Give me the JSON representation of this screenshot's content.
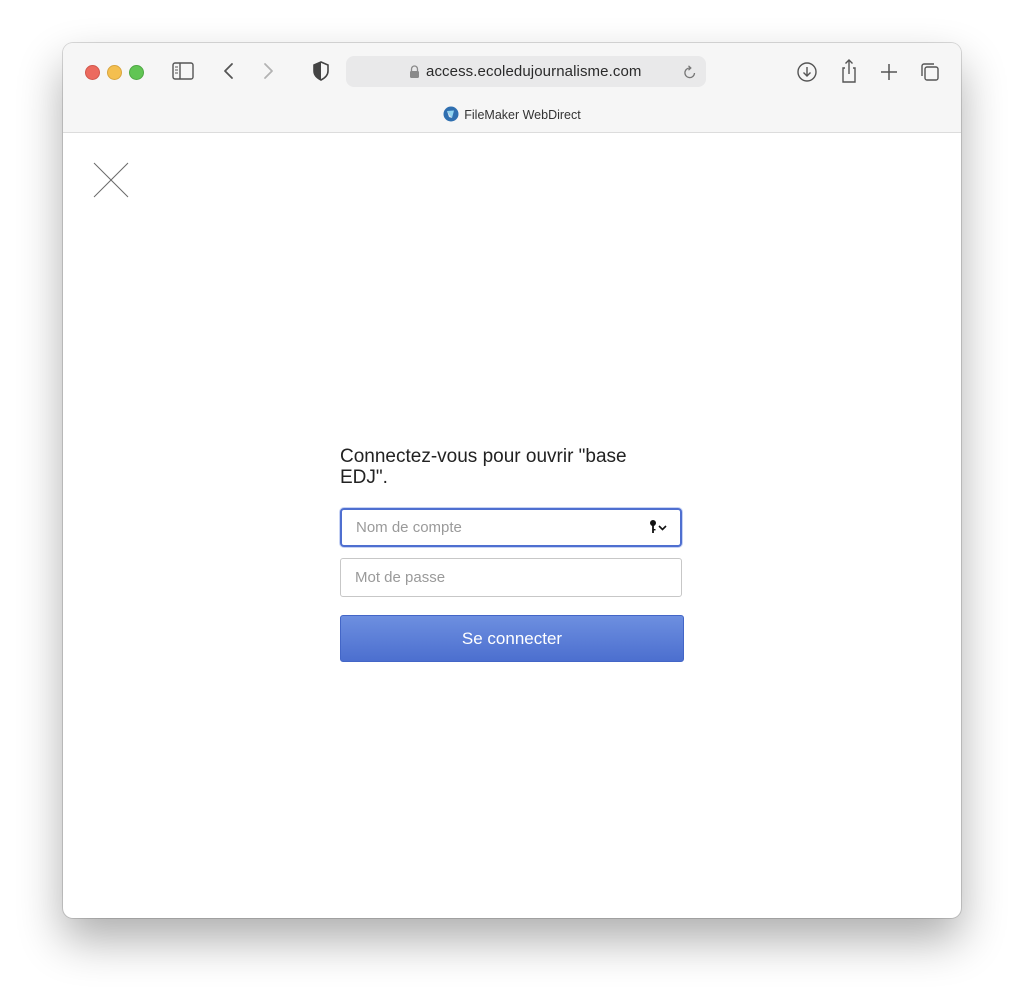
{
  "browser": {
    "url": "access.ecoledujournalisme.com",
    "tab_title": "FileMaker WebDirect",
    "toolbar_icons": [
      "sidebar-icon",
      "back-icon",
      "forward-icon",
      "shield-icon",
      "lock-icon",
      "reload-icon",
      "download-icon",
      "share-icon",
      "new-tab-icon",
      "tab-overview-icon"
    ]
  },
  "login": {
    "heading": "Connectez-vous pour ouvrir \"base EDJ\".",
    "account_placeholder": "Nom de compte",
    "password_placeholder": "Mot de passe",
    "submit_label": "Se connecter"
  },
  "colors": {
    "accent": "#4f6fd0",
    "button_top": "#6d8fe0",
    "button_bottom": "#4c6fcf"
  }
}
